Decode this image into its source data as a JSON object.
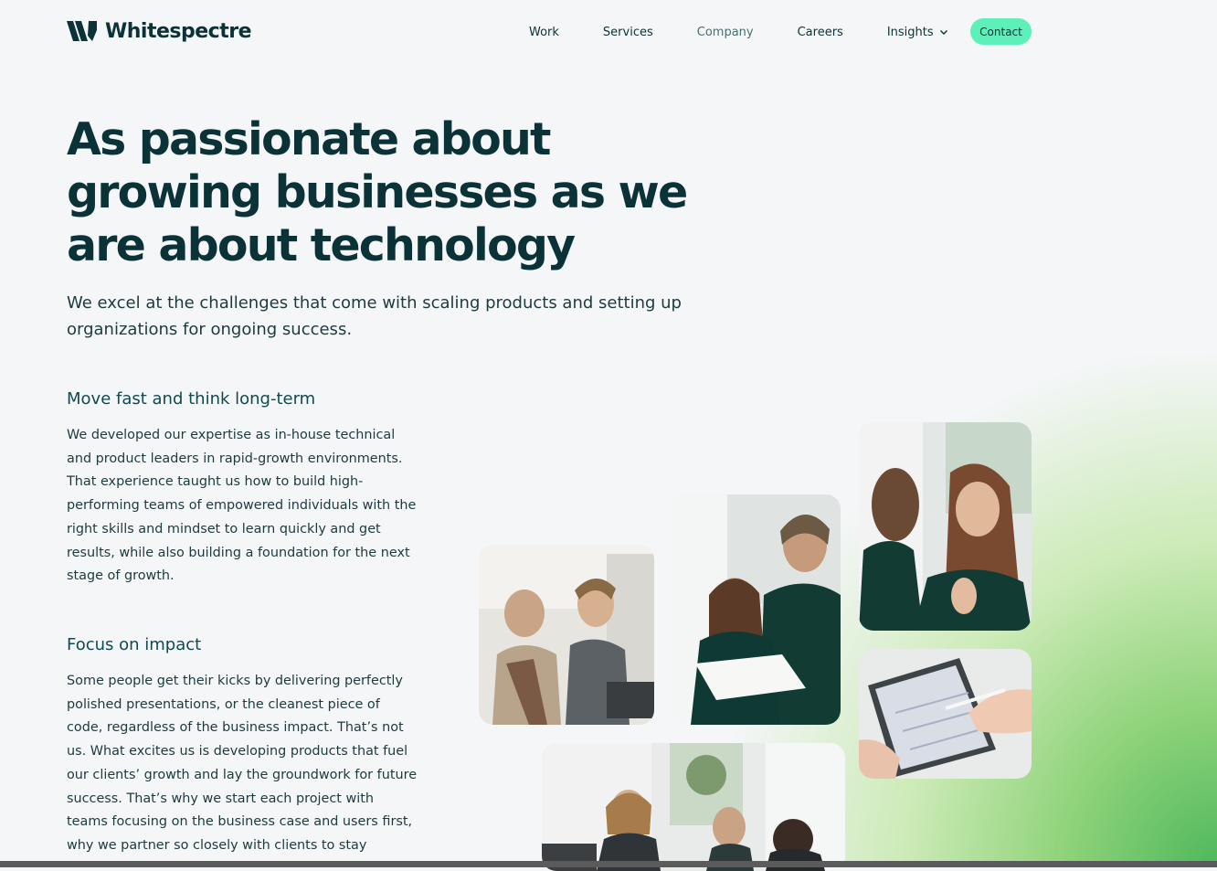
{
  "header": {
    "logo_text": "Whitespectre",
    "nav": {
      "work": "Work",
      "services": "Services",
      "company": "Company",
      "careers": "Careers",
      "insights": "Insights"
    },
    "contact_label": "Contact"
  },
  "hero": {
    "title": "As passionate about growing businesses as we are about technology",
    "subtitle": "We excel at the challenges that come with scaling products and setting up organizations for ongoing success."
  },
  "sections": [
    {
      "title": "Move fast and think long-term",
      "body": "We developed our expertise as in-house technical and product leaders in rapid-growth environments. That experience taught us how to build high-performing teams of empowered individuals with the right skills and mindset to learn quickly and get results, while also building a foundation for the next stage of growth."
    },
    {
      "title": "Focus on impact",
      "body": "Some people get their kicks by delivering perfectly polished presentations, or the cleanest piece of code, regardless of the business impact. That’s not us. What excites us is developing products that fuel our clients’ growth and lay the groundwork for future success. That’s why we start each project with teams focusing on the business case and users first, why we partner so closely with clients to stay"
    }
  ],
  "colors": {
    "brand_dark": "#0b3337",
    "accent": "#5ef0b9",
    "background": "#f4f6f8"
  },
  "icons": {
    "logo": "whitespectre-logo-icon",
    "dropdown": "chevron-down-icon"
  }
}
